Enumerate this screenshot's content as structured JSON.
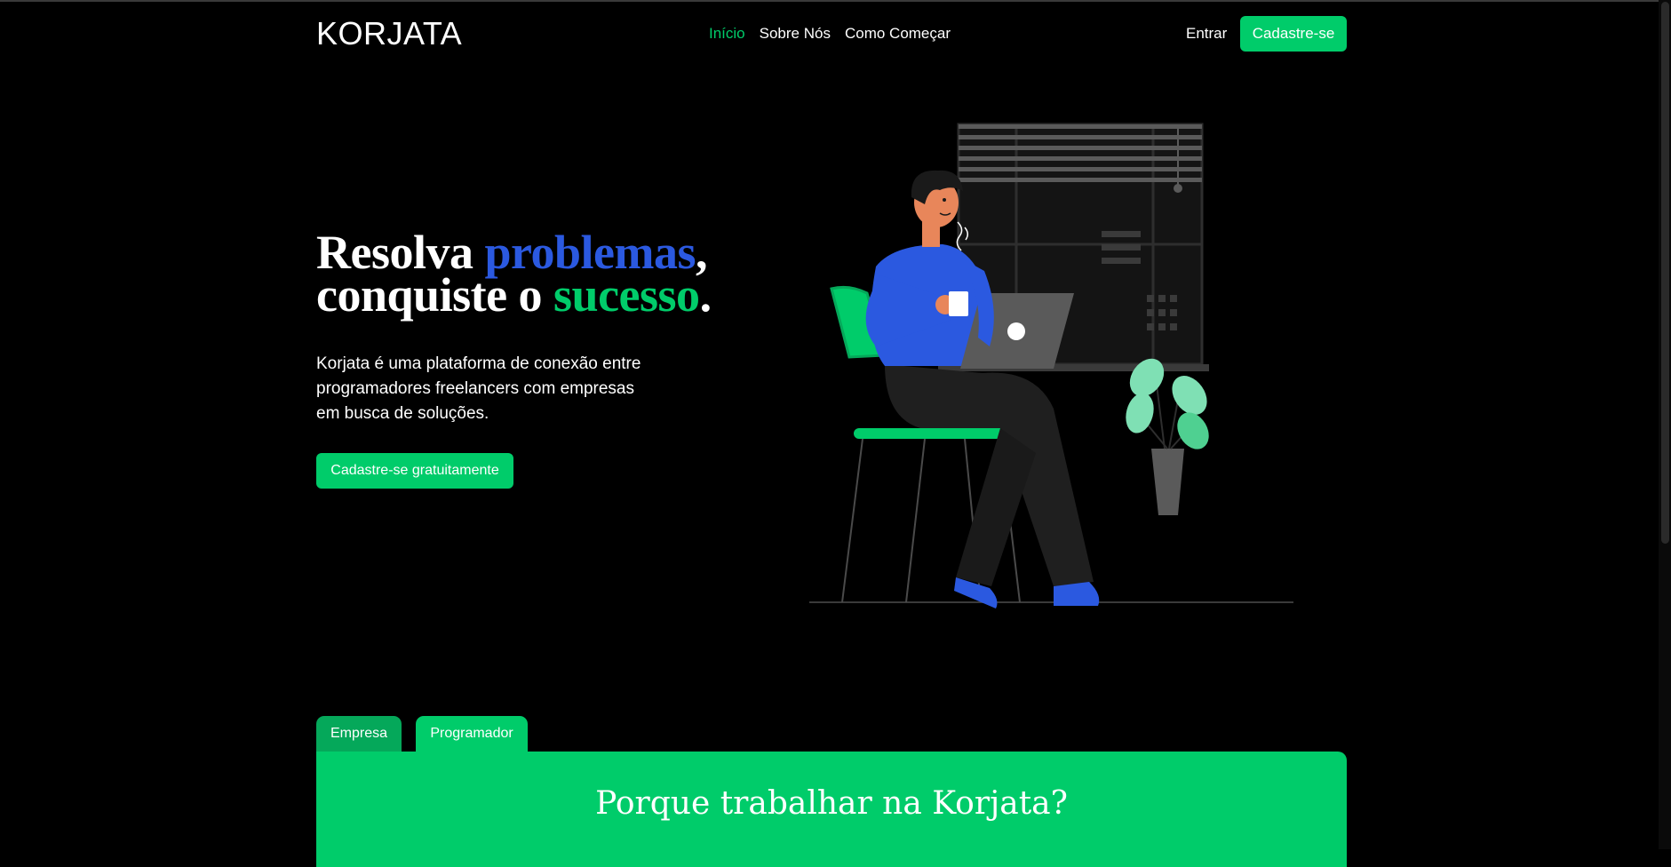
{
  "brand": {
    "logo": "KORJATA"
  },
  "nav": {
    "items": [
      {
        "label": "Início",
        "active": true
      },
      {
        "label": "Sobre Nós",
        "active": false
      },
      {
        "label": "Como Começar",
        "active": false
      }
    ],
    "login_label": "Entrar",
    "signup_label": "Cadastre-se"
  },
  "hero": {
    "title_part1": "Resolva ",
    "title_highlight1": "problemas",
    "title_part2": ",",
    "title_part3": "conquiste o ",
    "title_highlight2": "sucesso",
    "title_part4": ".",
    "description": "Korjata é uma plataforma de conexão entre programadores freelancers com empresas em busca de soluções.",
    "cta_label": "Cadastre-se gratuitamente"
  },
  "tabs": [
    {
      "label": "Empresa",
      "selected": false
    },
    {
      "label": "Programador",
      "selected": true
    }
  ],
  "panel": {
    "title": "Porque trabalhar na Korjata?"
  },
  "colors": {
    "accent_green": "#00cc6a",
    "accent_blue": "#2b59e0",
    "background": "#000000"
  }
}
